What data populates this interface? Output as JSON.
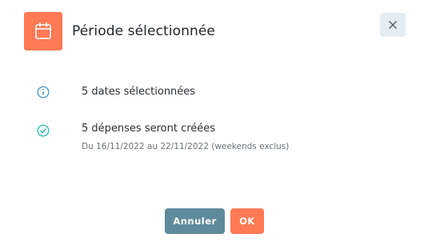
{
  "dialog": {
    "title": "Période sélectionnée",
    "header_icon": "calendar-icon",
    "close_icon": "close-icon",
    "accent_color": "#ff7a55",
    "secondary_color": "#5e8a9b",
    "info_icon_color": "#3b8ed0",
    "check_icon_color": "#17b3b6"
  },
  "rows": [
    {
      "icon": "info-circle-icon",
      "text": "5 dates sélectionnées"
    },
    {
      "icon": "check-circle-icon",
      "text": "5 dépenses seront créées",
      "subtext": "Du 16/11/2022 au 22/11/2022 (weekends exclus)"
    }
  ],
  "buttons": {
    "cancel_label": "Annuler",
    "ok_label": "OK"
  }
}
